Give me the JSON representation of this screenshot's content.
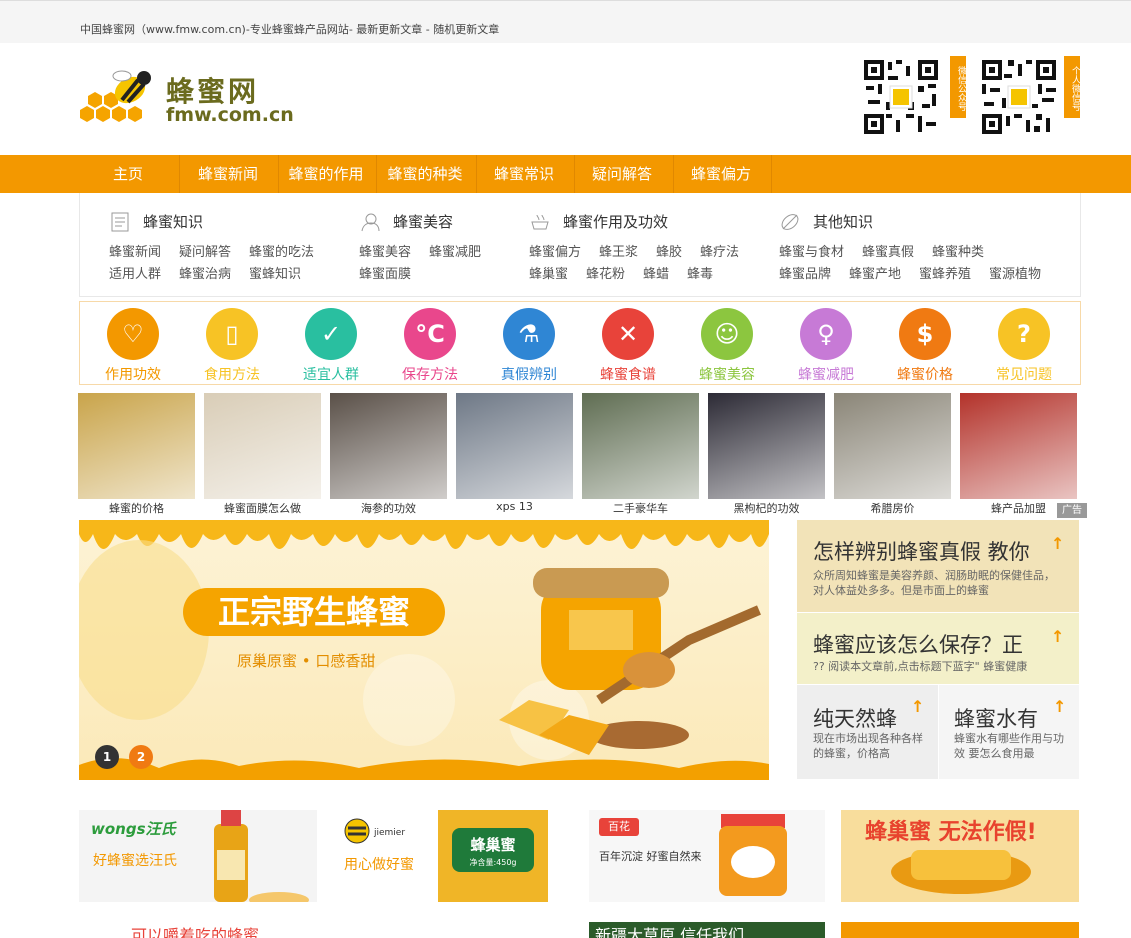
{
  "topbar": {
    "text": "中国蜂蜜网（www.fmw.com.cn)-专业蜂蜜蜂产品网站-  最新更新文章   -   随机更新文章"
  },
  "logo": {
    "cn": "蜂蜜网",
    "en": "fmw.com.cn"
  },
  "qr": [
    {
      "tag": "微信公众号"
    },
    {
      "tag": "个人微信号"
    }
  ],
  "nav": [
    "主页",
    "蜂蜜新闻",
    "蜂蜜的作用",
    "蜂蜜的种类",
    "蜂蜜常识",
    "疑问解答",
    "蜂蜜偏方"
  ],
  "categories": [
    {
      "title": "蜂蜜知识",
      "icon": "document-icon",
      "links": [
        "蜂蜜新闻",
        "疑问解答",
        "蜂蜜的吃法",
        "适用人群",
        "蜂蜜治病",
        "蜜蜂知识"
      ]
    },
    {
      "title": "蜂蜜美容",
      "icon": "person-icon",
      "links": [
        "蜂蜜美容",
        "蜂蜜减肥",
        "蜂蜜面膜"
      ]
    },
    {
      "title": "蜂蜜作用及功效",
      "icon": "cup-icon",
      "links": [
        "蜂蜜偏方",
        "蜂王浆",
        "蜂胶",
        "蜂疗法",
        "蜂巢蜜",
        "蜂花粉",
        "蜂蜡",
        "蜂毒"
      ]
    },
    {
      "title": "其他知识",
      "icon": "leaf-icon",
      "links": [
        "蜂蜜与食材",
        "蜂蜜真假",
        "蜂蜜种类",
        "蜂蜜品牌",
        "蜂蜜产地",
        "蜜蜂养殖",
        "蜜源植物"
      ]
    }
  ],
  "icon_strip": [
    {
      "label": "作用功效",
      "icon": "heart-icon",
      "glyph": "♡",
      "color": "#f39800"
    },
    {
      "label": "食用方法",
      "icon": "glass-icon",
      "glyph": "▯",
      "color": "#f7c325"
    },
    {
      "label": "适宜人群",
      "icon": "check-icon",
      "glyph": "✓",
      "color": "#29bfa0"
    },
    {
      "label": "保存方法",
      "icon": "temperature-icon",
      "glyph": "°C",
      "color": "#e9478c"
    },
    {
      "label": "真假辨别",
      "icon": "flask-icon",
      "glyph": "⚗",
      "color": "#2f86d4"
    },
    {
      "label": "蜂蜜食谱",
      "icon": "cutlery-icon",
      "glyph": "✕",
      "color": "#e8433a"
    },
    {
      "label": "蜂蜜美容",
      "icon": "mask-icon",
      "glyph": "☺",
      "color": "#8cc63f"
    },
    {
      "label": "蜂蜜减肥",
      "icon": "body-icon",
      "glyph": "♀",
      "color": "#c77ad6"
    },
    {
      "label": "蜂蜜价格",
      "icon": "dollar-icon",
      "glyph": "$",
      "color": "#f07a12"
    },
    {
      "label": "常见问题",
      "icon": "question-icon",
      "glyph": "?",
      "color": "#f7c325"
    }
  ],
  "thumbs": [
    {
      "caption": "蜂蜜的价格",
      "bg": "#c9a44a"
    },
    {
      "caption": "蜂蜜面膜怎么做",
      "bg": "#d9cdb7"
    },
    {
      "caption": "海参的功效",
      "bg": "#5a5048"
    },
    {
      "caption": "xps 13",
      "bg": "#6e7886"
    },
    {
      "caption": "二手豪华车",
      "bg": "#5f6d52"
    },
    {
      "caption": "黑枸杞的功效",
      "bg": "#2c2a35"
    },
    {
      "caption": "希腊房价",
      "bg": "#8a8577"
    },
    {
      "caption": "蜂产品加盟",
      "bg": "#b3322a"
    }
  ],
  "ad_tag": "广告",
  "hero": {
    "title": "正宗野生蜂蜜",
    "subtitle": "原巢原蜜  •  口感香甜",
    "dots": [
      "1",
      "2"
    ]
  },
  "side_cards": [
    {
      "title": "怎样辨别蜂蜜真假 教你",
      "desc": "众所周知蜂蜜是美容养颜、润肠助眠的保健佳品，对人体益处多多。但是市面上的蜂蜜",
      "bg": "#f2e3b8"
    },
    {
      "title": "蜂蜜应该怎么保存？正",
      "desc": "?? 阅读本文章前,点击标题下蓝字\" 蜂蜜健康",
      "bg": "#f3f0c9"
    },
    {
      "title": "纯天然蜂",
      "desc": "现在市场出现各种各样的蜂蜜，价格高",
      "bg": "#eeeeee"
    },
    {
      "title": "蜂蜜水有",
      "desc": "蜂蜜水有哪些作用与功效 要怎么食用最",
      "bg": "#f5f5f5"
    }
  ],
  "banners": [
    {
      "brand": "wongs汪氏",
      "text": "好蜂蜜选汪氏"
    },
    {
      "brand": "jiemier",
      "text": "用心做好蜜",
      "product": "蜂巢蜜",
      "weight": "净含量:450g"
    },
    {
      "brand": "百花",
      "text": "百年沉淀 好蜜自然来"
    },
    {
      "text": "蜂巢蜜 无法作假!"
    }
  ],
  "bottom_row": [
    {
      "text": "可以嚼着吃的蜂蜜"
    },
    {
      "text": "新疆大草原 信任我们"
    }
  ]
}
